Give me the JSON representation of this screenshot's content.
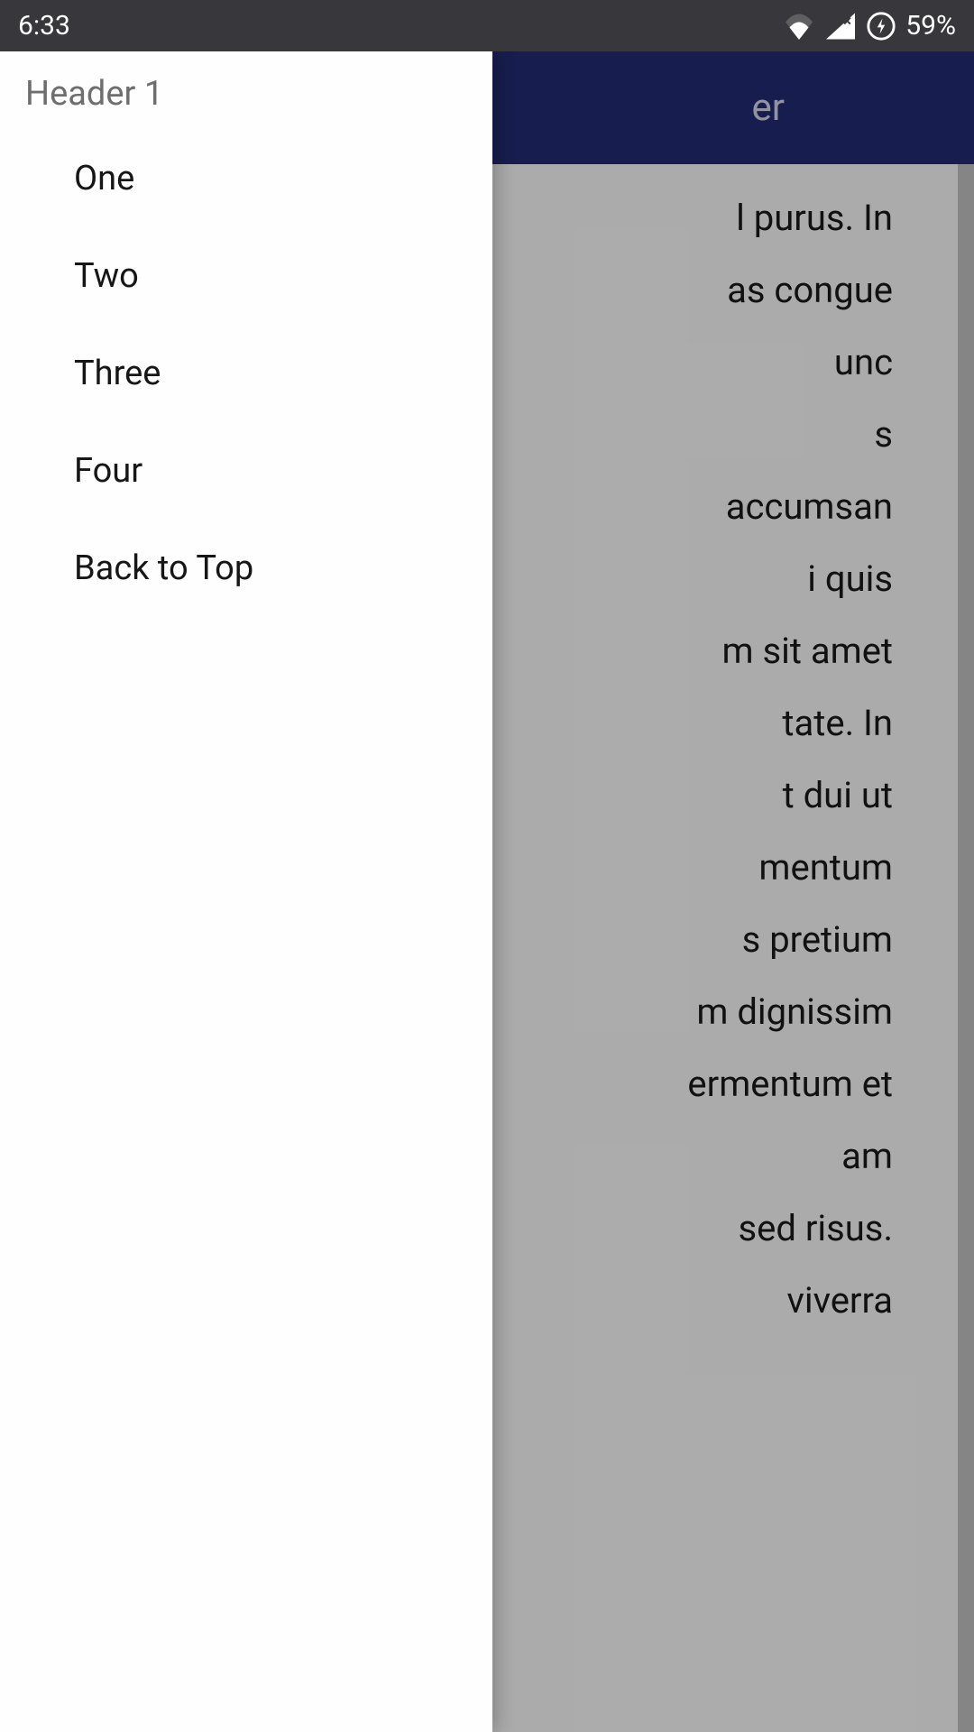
{
  "status_bar": {
    "time": "6:33",
    "battery_pct": "59%"
  },
  "app_bar": {
    "title_fragment": "er"
  },
  "drawer": {
    "header": "Header 1",
    "items": [
      {
        "label": "One"
      },
      {
        "label": "Two"
      },
      {
        "label": "Three"
      },
      {
        "label": "Four"
      },
      {
        "label": "Back to Top"
      }
    ]
  },
  "content": {
    "visible_lines": [
      "l purus. In",
      "as congue",
      "unc",
      "s",
      "accumsan",
      "i quis",
      "m sit amet",
      "tate. In",
      "t dui ut",
      "mentum",
      "s pretium",
      "m dignissim",
      "ermentum et",
      "am",
      "sed risus.",
      "viverra"
    ]
  }
}
